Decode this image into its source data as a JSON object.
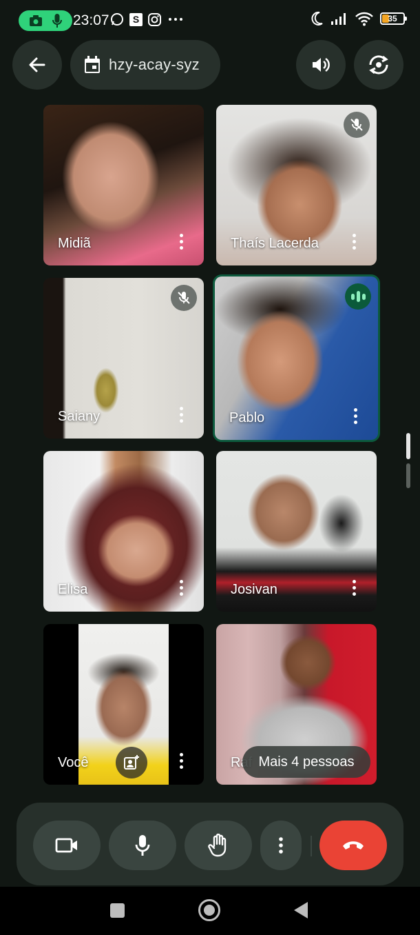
{
  "status_bar": {
    "time": "23:07",
    "battery": "35",
    "icons": [
      "camera-icon",
      "mic-icon",
      "whatsapp-icon",
      "s-icon",
      "instagram-icon",
      "more-icon",
      "moon-icon",
      "signal-icon",
      "wifi-icon",
      "battery-icon"
    ]
  },
  "header": {
    "meeting_code": "hzy-acay-syz"
  },
  "participants": [
    {
      "name": "Midiã",
      "muted": false,
      "speaking": false
    },
    {
      "name": "Thaís Lacerda",
      "muted": true,
      "speaking": false
    },
    {
      "name": "Saiany",
      "muted": true,
      "speaking": false
    },
    {
      "name": "Pablo",
      "muted": false,
      "speaking": true
    },
    {
      "name": "Elisa",
      "muted": false,
      "speaking": false
    },
    {
      "name": "Josivan",
      "muted": false,
      "speaking": false
    },
    {
      "name": "Você",
      "muted": false,
      "speaking": false
    },
    {
      "name": "Raf",
      "muted": false,
      "speaking": false
    }
  ],
  "overflow": {
    "more_people_label": "Mais 4 pessoas"
  },
  "colors": {
    "background": "#111713",
    "surface": "#27302b",
    "end_call": "#ea4335",
    "speaking_border": "#0d5a3d",
    "rec_pill": "#2fd27a"
  }
}
